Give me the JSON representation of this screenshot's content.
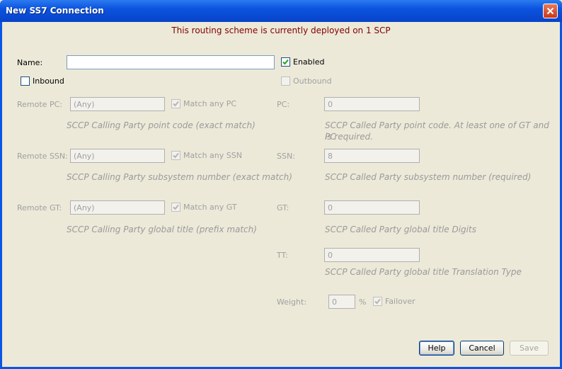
{
  "window": {
    "title": "New SS7 Connection"
  },
  "banner": "This routing scheme is currently deployed on 1 SCP",
  "name": {
    "label": "Name:",
    "value": ""
  },
  "enabled": {
    "label": "Enabled",
    "checked": true
  },
  "inbound": {
    "label": "Inbound",
    "checked": false
  },
  "outbound": {
    "label": "Outbound",
    "checked": false
  },
  "left": {
    "remote_pc": {
      "label": "Remote PC:",
      "value": "(Any)",
      "match_label": "Match any PC",
      "help": "SCCP Calling Party point code (exact match)"
    },
    "remote_ssn": {
      "label": "Remote SSN:",
      "value": "(Any)",
      "match_label": "Match any SSN",
      "help": "SCCP Calling Party subsystem number (exact match)"
    },
    "remote_gt": {
      "label": "Remote GT:",
      "value": "(Any)",
      "match_label": "Match any GT",
      "help": "SCCP Calling Party global title (prefix match)"
    }
  },
  "right": {
    "pc": {
      "label": "PC:",
      "value": "0",
      "help_line1": "SCCP Called Party point code. At least one of GT and PC",
      "help_line2": "is required."
    },
    "ssn": {
      "label": "SSN:",
      "value": "8",
      "help": "SCCP Called Party subsystem number (required)"
    },
    "gt": {
      "label": "GT:",
      "value": "0",
      "help": "SCCP Called Party global title Digits"
    },
    "tt": {
      "label": "TT:",
      "value": "0",
      "help": "SCCP Called Party global title Translation Type"
    },
    "weight": {
      "label": "Weight:",
      "value": "0",
      "unit": "%",
      "failover_label": "Failover"
    }
  },
  "buttons": {
    "help": "Help",
    "cancel": "Cancel",
    "save": "Save"
  }
}
